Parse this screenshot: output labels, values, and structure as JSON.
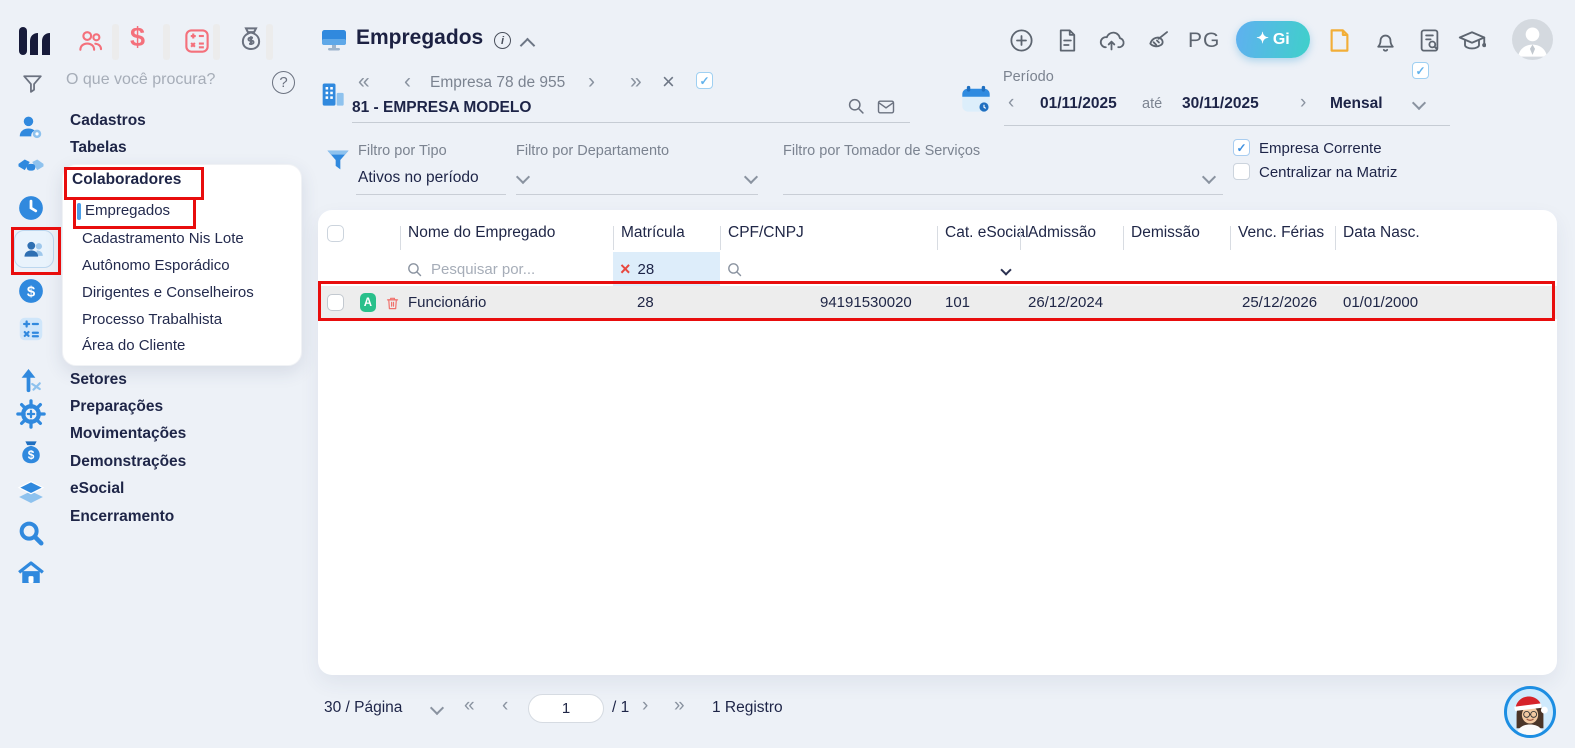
{
  "colors": {
    "page_bg": "#edf1f7",
    "accent_blue": "#3089de",
    "navy_text": "#212849",
    "gray_text": "#7b8390",
    "coral_icon": "#f4707b",
    "annotation_red": "#e80d0d",
    "green_badge": "#29c08b",
    "trash_red": "#f0726d",
    "gi_gradient_start": "#5fb0f0",
    "gi_gradient_end": "#3fd0ca",
    "yellow_icon": "#f2ae37",
    "row_highlight_bg": "#ededed",
    "matricula_filter_bg": "#ddedfa"
  },
  "glyphs": {
    "double_prev": "«",
    "prev": "‹",
    "next": "›",
    "double_next": "»",
    "close": "×",
    "check": "✓",
    "sparkle": "✦",
    "question": "?",
    "dollar": "$"
  },
  "topbar": {
    "pg_label": "PG",
    "gi_label": "Gi"
  },
  "sidebar": {
    "search_placeholder": "O que você procura?",
    "menu": [
      "Cadastros",
      "Tabelas",
      "Colaboradores",
      "Setores",
      "Preparações",
      "Movimentações",
      "Demonstrações",
      "eSocial",
      "Encerramento"
    ],
    "submenu": [
      "Empregados",
      "Cadastramento Nis Lote",
      "Autônomo Esporádico",
      "Dirigentes e Conselheiros",
      "Processo Trabalhista",
      "Área do Cliente"
    ]
  },
  "header": {
    "title": "Empregados",
    "company_pager_label": "Empresa 78 de 955",
    "company_name": "81 - EMPRESA MODELO",
    "period": {
      "label": "Período",
      "start_date": "01/11/2025",
      "separator": "até",
      "end_date": "30/11/2025",
      "mode": "Mensal"
    }
  },
  "filters": {
    "tipo_label": "Filtro por Tipo",
    "tipo_value": "Ativos no período",
    "departamento_label": "Filtro por Departamento",
    "tomador_label": "Filtro por Tomador de Serviços",
    "empresa_corrente_label": "Empresa Corrente",
    "centralizar_matriz_label": "Centralizar na Matriz"
  },
  "table": {
    "columns": [
      "Nome do Empregado",
      "Matrícula",
      "CPF/CNPJ",
      "Cat. eSocial",
      "Admissão",
      "Demissão",
      "Venc. Férias",
      "Data Nasc."
    ],
    "search_placeholder": "Pesquisar por...",
    "matricula_filter_value": "28",
    "rows": [
      {
        "status_badge": "A",
        "nome": "Funcionário",
        "matricula": "28",
        "cpf_cnpj": "94191530020",
        "cat_esocial": "101",
        "admissao": "26/12/2024",
        "demissao": "",
        "venc_ferias": "25/12/2026",
        "data_nasc": "01/01/2000"
      }
    ]
  },
  "pagination": {
    "per_page_label": "30 / Página",
    "current_page": "1",
    "total_pages_label": "/ 1",
    "records_label": "1 Registro"
  }
}
